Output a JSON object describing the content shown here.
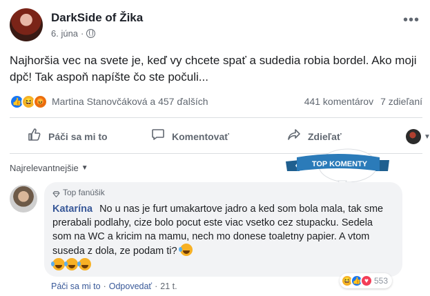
{
  "post": {
    "author": "DarkSide of Žika",
    "date": "6. júna",
    "text": "Najhoršia vec na svete je, keď vy chcete spať a sudedia robia bordel. Ako moji dpč! Tak aspoň napíšte čo ste počuli...",
    "reaction_names": "Martina Stanovčáková a 457 ďalších",
    "comments_count": "441 komentárov",
    "shares_count": "7 zdieľaní"
  },
  "actions": {
    "like": "Páči sa mi to",
    "comment": "Komentovať",
    "share": "Zdieľať"
  },
  "sort_label": "Najrelevantnejšie",
  "top_comment_badge": "TOP KOMENTY",
  "comment": {
    "fan_badge": "Top fanúšik",
    "author": "Katarína",
    "text": "No u nas je furt umakartove jadro a ked som bola mala, tak sme prerabali podlahy, cize bolo pocut este viac vsetko cez stupacku. Sedela som na WC a kricim na mamu, nech mo donese toaletny papier. A vtom suseda z dola, ze podam ti?",
    "reaction_count": "553",
    "like_label": "Páči sa mi to",
    "reply_label": "Odpovedať",
    "time": "21 t.",
    "separator": "·"
  },
  "colors": {
    "link": "#385898",
    "like_blue": "#1877f2",
    "badge_blue": "#2b7bb9",
    "bubble_bg": "#f2f3f5"
  },
  "icons": [
    "globe-icon",
    "more-icon",
    "thumbs-up-icon",
    "comment-icon",
    "share-icon",
    "caret-down-icon",
    "diamond-icon",
    "laughing-emoji-icon"
  ]
}
